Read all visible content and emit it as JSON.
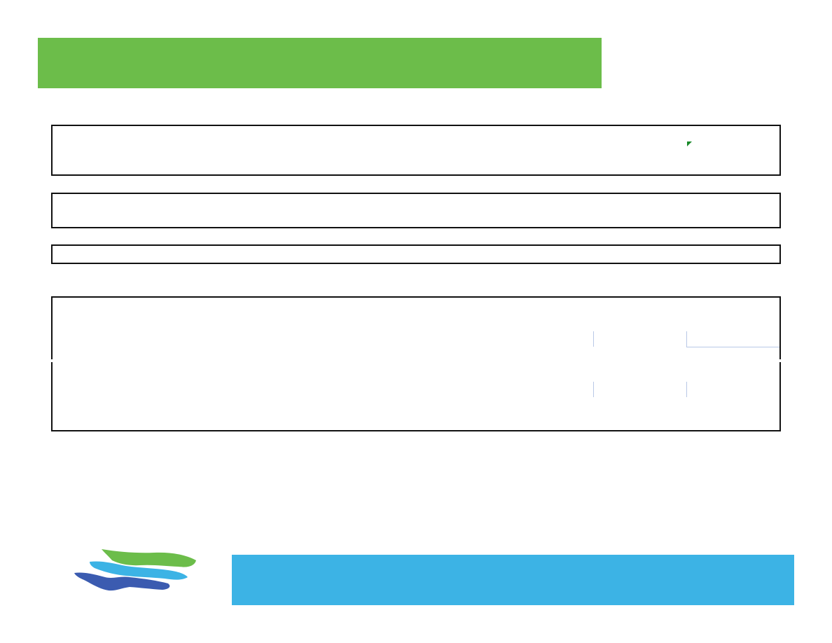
{
  "slide": {
    "title_banner": {
      "color": "#6cbd4a",
      "text": ""
    },
    "footer_banner": {
      "color": "#3cb3e5",
      "text": ""
    },
    "logo": {
      "icon": "brushstroke-logo-icon",
      "colors": [
        "#6cbd4a",
        "#3cb3e5",
        "#3b5bb0"
      ]
    }
  },
  "content_boxes": [
    {
      "text": ""
    },
    {
      "text": ""
    },
    {
      "text": ""
    },
    {
      "rows": [
        {
          "cells": [
            "",
            "",
            ""
          ]
        },
        {
          "cells": [
            "",
            "",
            ""
          ]
        }
      ]
    }
  ],
  "colors": {
    "border": "#111111",
    "table_rule": "#b8c8e6",
    "marker": "#1a8a2a"
  }
}
